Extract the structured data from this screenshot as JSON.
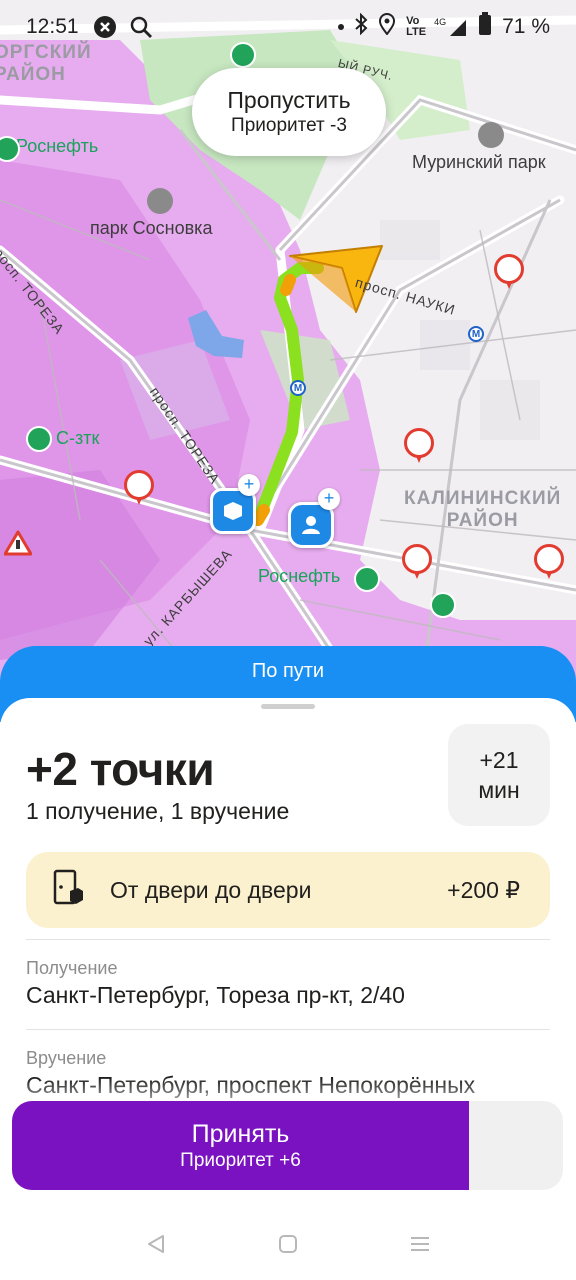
{
  "status_bar": {
    "time": "12:51",
    "battery": "71 %",
    "network": "4G",
    "icons": [
      "shazam-icon",
      "search-icon",
      "dot-icon",
      "bluetooth-icon",
      "location-icon",
      "volte-icon",
      "signal-icon",
      "battery-icon"
    ]
  },
  "map": {
    "skip": {
      "title": "Пропустить",
      "subtitle": "Приоритет -3"
    },
    "labels": {
      "district_top_left": "ОРГСКИЙ\nРАЙОН",
      "district_right": "КАЛИНИНСКИЙ\nРАЙОН",
      "murinsky_park": "Муринский парк",
      "park_sosnovka": "парк Сосновка",
      "rosneft_1": "Роснефть",
      "rosneft_2": "Роснефть",
      "s_ztk": "С-зтк",
      "street_toreza_1": "просп. ТОРЕЗА",
      "street_toreza_2": "просп. ТОРЕЗА",
      "street_nauki": "просп. НАУКИ",
      "street_karbysheva": "ул. КАРБЫШЕВА",
      "street_ruch": "ЫЙ РУЧ."
    },
    "colors": {
      "route": "#8be01f",
      "route_start": "#f2a007",
      "navigator_arrow": "#f8b60f",
      "pin_blue": "#1e88e5",
      "camera_red": "#e23b2f",
      "traffic_purple": "#e9a6f0"
    }
  },
  "sheet": {
    "header_title": "По пути",
    "points_title": "+2 точки",
    "points_subtitle": "1 получение, 1 вручение",
    "extra_time_value": "+21",
    "extra_time_unit": "мин",
    "door_to_door": {
      "label": "От двери до двери",
      "price": "+200 ₽",
      "icon": "door-box-icon"
    },
    "pickup": {
      "caption": "Получение",
      "address": "Санкт-Петербург, Тореза пр-кт, 2/40"
    },
    "delivery": {
      "caption": "Вручение",
      "address": "Санкт-Петербург, проспект Непокорённых"
    }
  },
  "actions": {
    "accept_title": "Принять",
    "accept_subtitle": "Приоритет +6",
    "accent_color": "#7b12c1",
    "header_color": "#1a8ff3"
  },
  "nav_bar": {
    "icons": [
      "back-icon",
      "home-icon",
      "recents-icon"
    ]
  }
}
